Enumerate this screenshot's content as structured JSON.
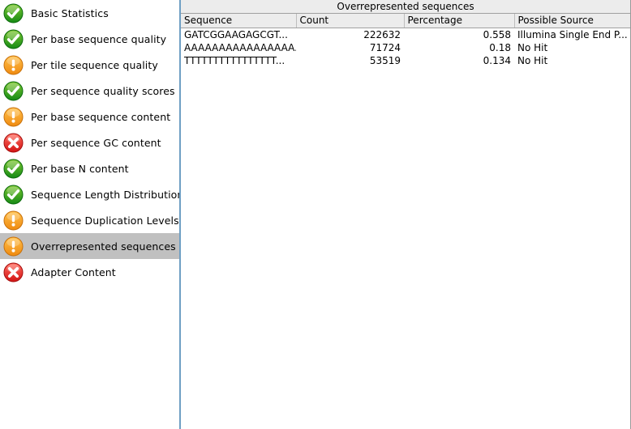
{
  "sidebar": {
    "modules": [
      {
        "label": "Basic Statistics",
        "status": "pass",
        "selected": false
      },
      {
        "label": "Per base sequence quality",
        "status": "pass",
        "selected": false
      },
      {
        "label": "Per tile sequence quality",
        "status": "warn",
        "selected": false
      },
      {
        "label": "Per sequence quality scores",
        "status": "pass",
        "selected": false
      },
      {
        "label": "Per base sequence content",
        "status": "warn",
        "selected": false
      },
      {
        "label": "Per sequence GC content",
        "status": "fail",
        "selected": false
      },
      {
        "label": "Per base N content",
        "status": "pass",
        "selected": false
      },
      {
        "label": "Sequence Length Distribution",
        "status": "pass",
        "selected": false
      },
      {
        "label": "Sequence Duplication Levels",
        "status": "warn",
        "selected": false
      },
      {
        "label": "Overrepresented sequences",
        "status": "warn",
        "selected": true
      },
      {
        "label": "Adapter Content",
        "status": "fail",
        "selected": false
      }
    ]
  },
  "panel": {
    "title": "Overrepresented sequences",
    "table": {
      "columns": [
        "Sequence",
        "Count",
        "Percentage",
        "Possible Source"
      ],
      "rows": [
        {
          "sequence": "GATCGGAAGAGCGT...",
          "count": "222632",
          "percentage": "0.558",
          "possible_source": "Illumina Single End P..."
        },
        {
          "sequence": "AAAAAAAAAAAAAAAA...",
          "count": "71724",
          "percentage": "0.18",
          "possible_source": "No Hit"
        },
        {
          "sequence": "TTTTTTTTTTTTTTTT...",
          "count": "53519",
          "percentage": "0.134",
          "possible_source": "No Hit"
        }
      ]
    }
  },
  "colors": {
    "pass_green": "#1f9a1f",
    "warn_orange": "#f0911e",
    "fail_red": "#e02020",
    "divider_blue": "#6f9fc4",
    "selection_gray": "#c0c0c0",
    "header_gray": "#ececec"
  }
}
